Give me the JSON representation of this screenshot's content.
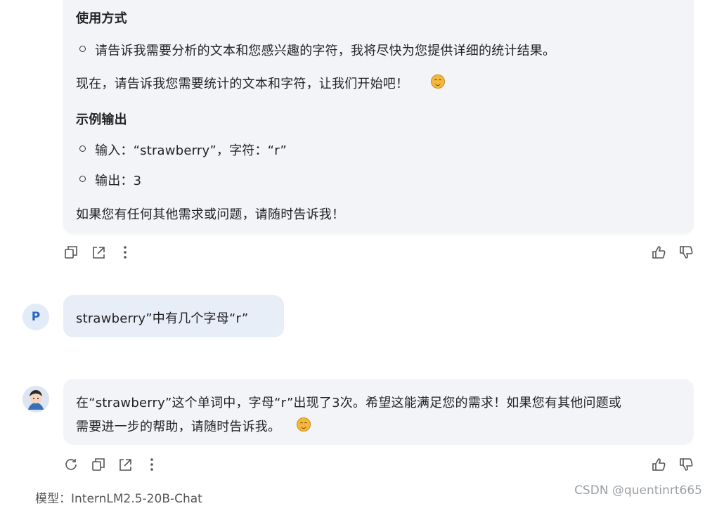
{
  "message1": {
    "usage_heading": "使用方式",
    "usage_item": "请告诉我需要分析的文本和您感兴趣的字符，我将尽快为您提供详细的统计结果。",
    "now_text": "现在，请告诉我您需要统计的文本和字符，让我们开始吧！",
    "example_heading": "示例输出",
    "example_input": "输入：“strawberry”，字符：“r”",
    "example_output": "输出：3",
    "closing": "如果您有任何其他需求或问题，请随时告诉我！"
  },
  "user_message": {
    "avatar_letter": "P",
    "text": "strawberry”中有几个字母“r”"
  },
  "reply": {
    "line1": "在“strawberry”这个单词中，字母“r”出现了3次。希望这能满足您的需求！如果您有其他问题或",
    "line2": "需要进一步的帮助，请随时告诉我。"
  },
  "footer": {
    "model": "模型：InternLM2.5-20B-Chat",
    "watermark": "CSDN @quentinrt665"
  },
  "icons": [
    "copy-icon",
    "share-icon",
    "more-icon",
    "thumbs-up-icon",
    "thumbs-down-icon",
    "regenerate-icon"
  ],
  "colors": {
    "bubble": "#f2f4f8",
    "user_bubble": "#e7eef8",
    "avatar_text": "#2b63c8"
  }
}
